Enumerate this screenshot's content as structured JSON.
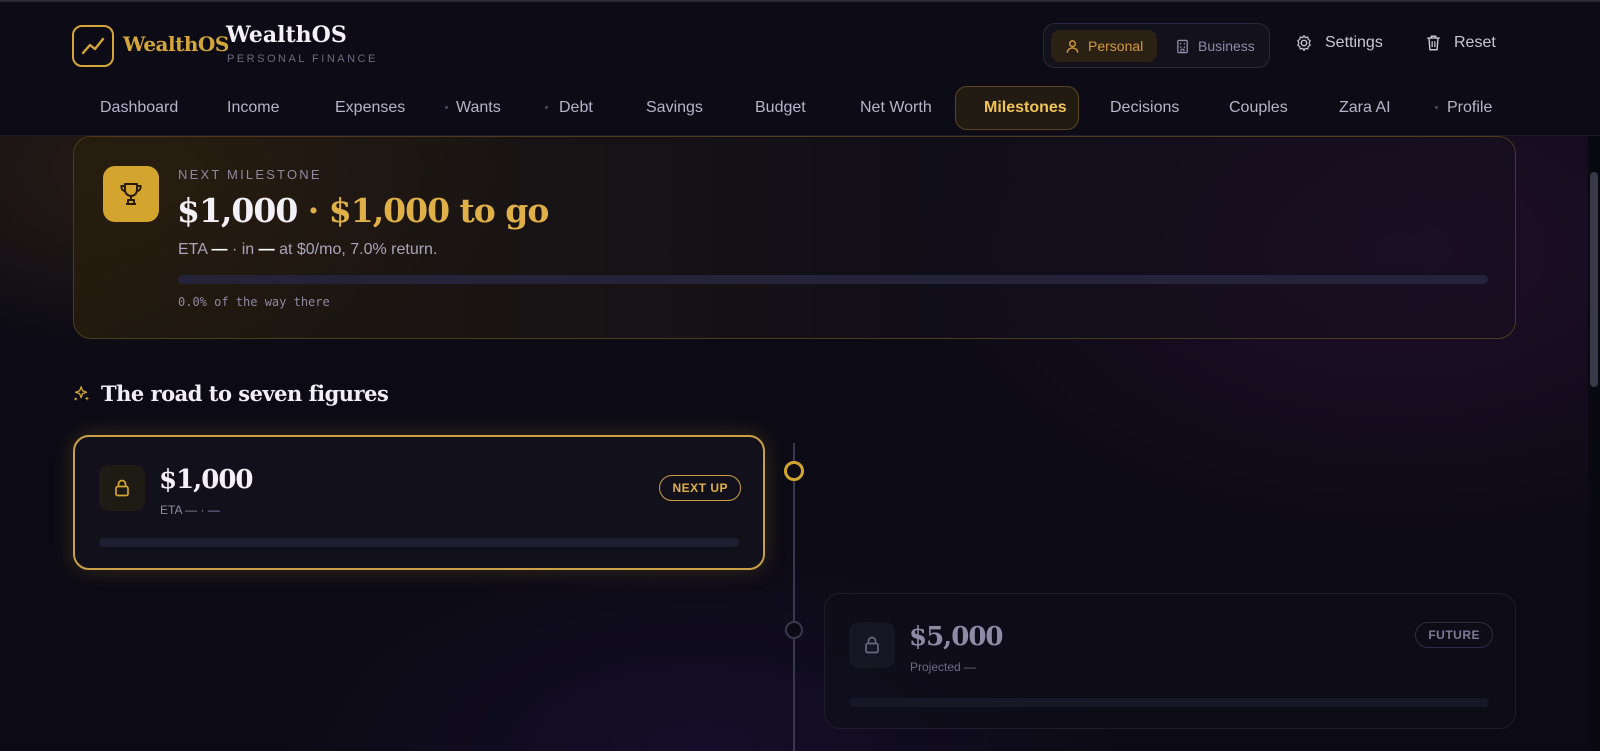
{
  "header": {
    "logo_word_1": "Wealth",
    "logo_word_2": "OS",
    "brand_title": "WealthOS",
    "brand_subtitle": "PERSONAL FINANCE",
    "mode": {
      "personal": "Personal",
      "business": "Business",
      "selected": "Personal"
    },
    "settings_label": "Settings",
    "reset_label": "Reset"
  },
  "nav": {
    "items": [
      {
        "label": "Dashboard"
      },
      {
        "label": "Income"
      },
      {
        "label": "Expenses"
      },
      {
        "label": "Wants"
      },
      {
        "label": "Debt"
      },
      {
        "label": "Savings"
      },
      {
        "label": "Budget"
      },
      {
        "label": "Net Worth"
      },
      {
        "label": "Milestones"
      },
      {
        "label": "Decisions"
      },
      {
        "label": "Couples"
      },
      {
        "label": "Zara AI"
      },
      {
        "label": "Profile"
      }
    ],
    "active": "Milestones"
  },
  "next_milestone": {
    "label": "NEXT MILESTONE",
    "amount": "$1,000",
    "separator": " · ",
    "to_go": "$1,000 to go",
    "eta_prefix": "ETA",
    "eta_value": "—",
    "eta_mid": "· in",
    "eta_in_value": "—",
    "eta_suffix": "at $0/mo, 7.0% return.",
    "progress": 0.0,
    "progress_text": "0.0% of the way there",
    "accent": "#d4a52e"
  },
  "road": {
    "title": "The road to seven figures",
    "milestones": [
      {
        "amount": "$1,000",
        "eta": "ETA — · —",
        "badge": "NEXT UP",
        "status": "next",
        "progress": 0.0
      },
      {
        "amount": "$5,000",
        "eta": "Projected —",
        "badge": "FUTURE",
        "status": "future",
        "progress": 0.0
      }
    ]
  }
}
